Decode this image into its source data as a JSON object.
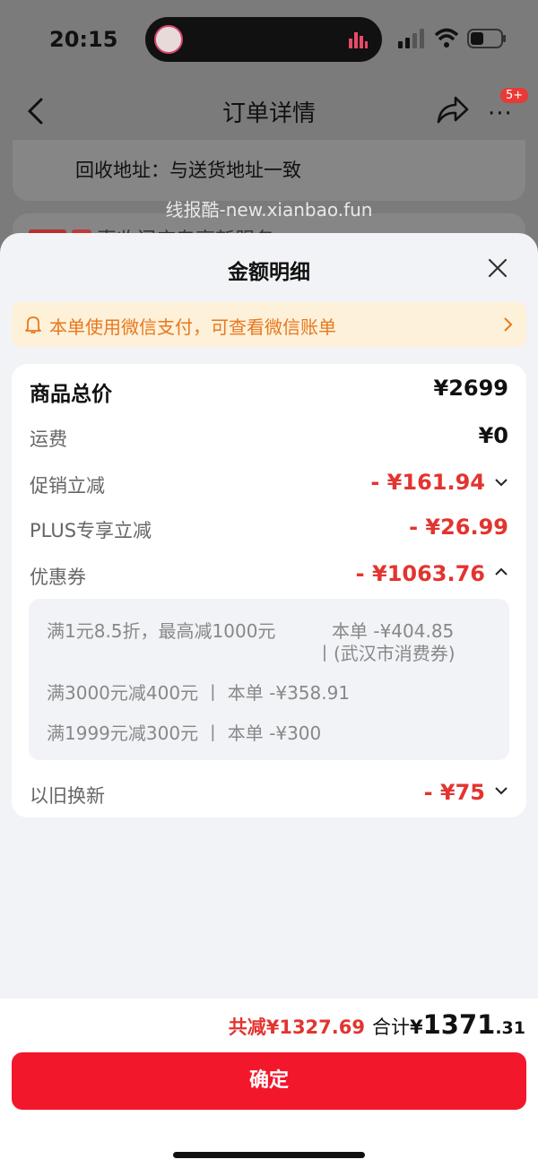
{
  "status_bar": {
    "time": "20:15"
  },
  "nav": {
    "title": "订单详情",
    "more_badge": "5+"
  },
  "background": {
    "address_text": "回收地址：与送货地址一致",
    "watermark": "线报酷-new.xianbao.fun",
    "peek_text": "惠收门店专享新服务 ›"
  },
  "sheet": {
    "title": "金额明细",
    "notice": "本单使用微信支付，可查看微信账单",
    "rows": {
      "goods_total": {
        "label": "商品总价",
        "value": "¥2699"
      },
      "shipping": {
        "label": "运费",
        "value": "¥0"
      },
      "promo": {
        "label": "促销立减",
        "value": "- ¥161.94"
      },
      "plus": {
        "label": "PLUS专享立减",
        "value": "- ¥26.99"
      },
      "coupon": {
        "label": "优惠券",
        "value": "- ¥1063.76"
      },
      "tradein": {
        "label": "以旧换新",
        "value": "- ¥75"
      }
    },
    "coupon_details": [
      {
        "desc": "满1元8.5折，最高减1000元",
        "amount": "本单 -¥404.85",
        "note": "丨(武汉市消费券)"
      },
      {
        "desc": "满3000元减400元 丨 本单 -¥358.91"
      },
      {
        "desc": "满1999元减300元 丨 本单 -¥300"
      }
    ]
  },
  "footer": {
    "saved": "共减¥1327.69",
    "sum_label": "合计",
    "sum_yen": "¥",
    "sum_int": "1371",
    "sum_dec": ".31",
    "confirm_label": "确定"
  },
  "colors": {
    "accent": "#f3172c",
    "discount": "#e3342f",
    "notice_text": "#e8781e",
    "notice_bg": "#fdf1d9"
  }
}
